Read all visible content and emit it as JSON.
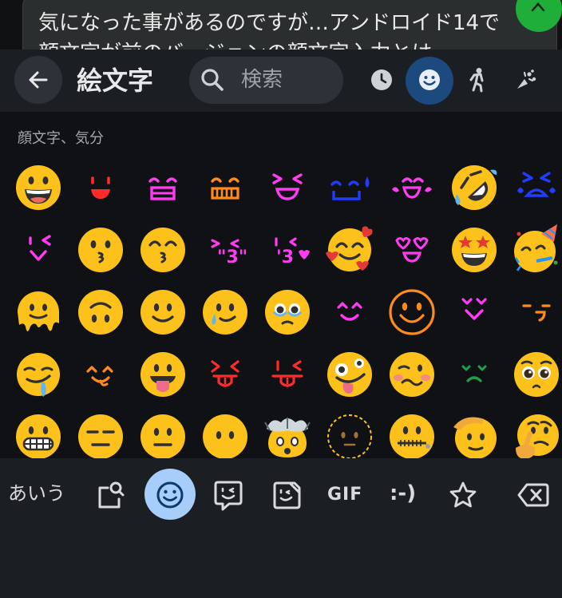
{
  "chat": {
    "line1": "気になった事があるのですが…アンドロイド14で",
    "line2": "顔文字が前のバージョンの顔文字入力とは…"
  },
  "header": {
    "title": "絵文字",
    "search_placeholder": "検索",
    "categories": [
      "recent-clock-icon",
      "smiley-icon",
      "person-icon",
      "activity-icon"
    ],
    "active_category": "smiley-icon"
  },
  "section": {
    "label": "顔文字、気分"
  },
  "emoji_rows": [
    [
      "grinning-face",
      "kaomoji-red-smile",
      "kaomoji-magenta-box",
      "kaomoji-orange-teeth",
      "kaomoji-magenta-squint",
      "kaomoji-blue-sweat",
      "kaomoji-magenta-laugh",
      "rolling-on-floor-laughing",
      "kaomoji-blue-crying"
    ],
    [
      "kaomoji-magenta-wink",
      "kissing-face",
      "kissing-smiling-eyes",
      "kaomoji-magenta-kiss",
      "kaomoji-magenta-heart-kiss",
      "smiling-face-with-hearts",
      "kaomoji-magenta-heart-eyes",
      "star-struck",
      "partying-face"
    ],
    [
      "melting-face",
      "upside-down-face",
      "slightly-smiling-face",
      "smiling-face-with-tear",
      "face-holding-back-tears",
      "kaomoji-magenta-happy",
      "smiley-outline",
      "kaomoji-magenta-v",
      "kaomoji-orange-smirk"
    ],
    [
      "drooling-face",
      "kaomoji-orange-yum",
      "face-with-tongue",
      "kaomoji-red-tongue",
      "kaomoji-red-tongue-wink",
      "zany-face",
      "woozy-face",
      "kaomoji-green-sad",
      "pleading-face"
    ],
    [
      "grimacing-face",
      "expressionless-face",
      "neutral-face",
      "face-without-mouth",
      "exploding-head",
      "dotted-line-face",
      "zipper-mouth-face",
      "saluting-face",
      "thinking-face"
    ]
  ],
  "bottom_bar": {
    "abc": "あいう",
    "gif": "GIF",
    "emoticon": ":-)"
  },
  "colors": {
    "accent_active_top": "#1c4a7e",
    "accent_active_bottom": "#a7cdfb",
    "fab_green": "#1fae3a",
    "panel_bg": "#0f1115",
    "bar_bg": "#1b1e23",
    "kaomoji_magenta": "#ff3cf2",
    "kaomoji_red": "#ff2a2a",
    "kaomoji_orange": "#ff8c1a",
    "kaomoji_blue": "#1f3cff",
    "kaomoji_green": "#1ea04a"
  }
}
